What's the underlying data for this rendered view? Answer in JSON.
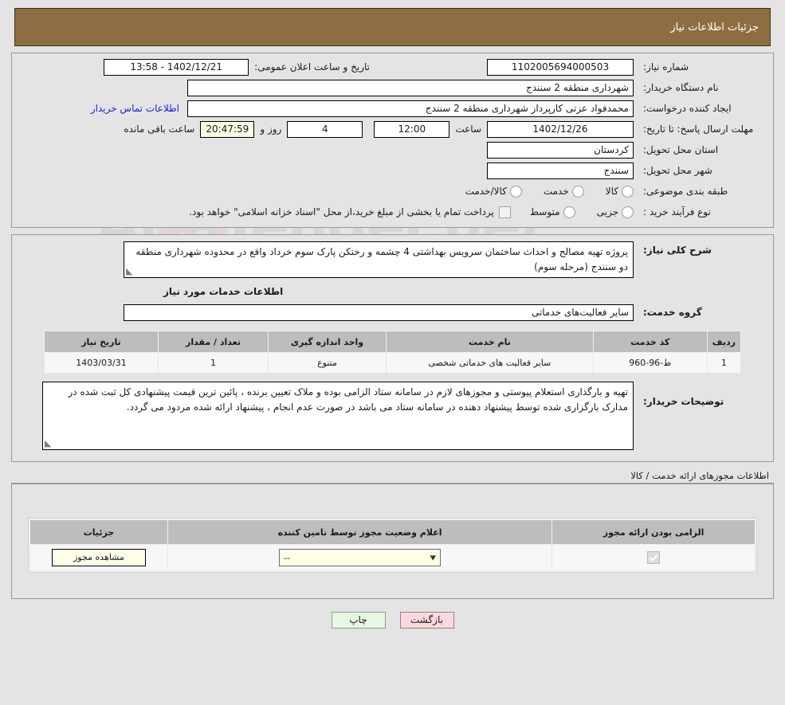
{
  "header": {
    "title": "جزئیات اطلاعات نیاز"
  },
  "form": {
    "need_number_label": "شماره نیاز:",
    "need_number_value": "1102005694000503",
    "public_announce_label": "تاریخ و ساعت اعلان عمومی:",
    "public_announce_value": "13:58 - 1402/12/21",
    "buyer_org_label": "نام دستگاه خریدار:",
    "buyer_org_value": "شهرداری منطقه 2 سنندج",
    "creator_label": "ایجاد کننده درخواست:",
    "creator_value": "محمدفواد عزتی کارپرداز شهرداری منطقه 2 سنندج",
    "contact_link": "اطلاعات تماس خریدار",
    "deadline_label": "مهلت ارسال پاسخ: تا تاریخ:",
    "deadline_date": "1402/12/26",
    "hour_label": "ساعت",
    "deadline_time": "12:00",
    "days_value": "4",
    "days_label": "روز و",
    "countdown_value": "20:47:59",
    "remaining_label": "ساعت باقی مانده",
    "province_label": "استان محل تحویل:",
    "province_value": "کردستان",
    "city_label": "شهر محل تحویل:",
    "city_value": "سنندج",
    "classification_label": "طبقه بندی موضوعی:",
    "classification_options": [
      "کالا",
      "خدمت",
      "کالا/خدمت"
    ],
    "purchase_type_label": "نوع فرآیند خرید :",
    "purchase_type_options": [
      "جزیی",
      "متوسط"
    ],
    "treasury_note": "پرداخت تمام یا بخشی از مبلغ خرید،از محل \"اسناد خزانه اسلامی\" خواهد بود."
  },
  "need": {
    "summary_label": "شرح کلی نیاز:",
    "summary_value": "پروژه تهیه مصالح و احداث ساختمان سرویس بهداشتی 4 چشمه و رختکن پارک سوم خرداد واقع در محدوده شهرداری منطقه دو سنندج (مرحله سوم)",
    "services_heading": "اطلاعات خدمات مورد نیاز",
    "service_group_label": "گروه خدمت:",
    "service_group_value": "سایر فعالیت‌های خدماتی",
    "notes_label": "توضیحات خریدار:",
    "notes_value": "تهیه و بارگذاری استعلام پیوستی و مجوزهای لازم در سامانه ستاد الزامی بوده و ملاک تعیین برنده ، پائین ترین قیمت پیشنهادی کل ثبت شده در مدارک بارگزاری شده توسط پیشنهاد دهنده در سامانه ستاد می باشد در صورت عدم انجام ، پیشنهاد ارائه شده مردود می گردد."
  },
  "services_table": {
    "columns": [
      "ردیف",
      "کد خدمت",
      "نام خدمت",
      "واحد اندازه گیری",
      "تعداد / مقدار",
      "تاریخ نیاز"
    ],
    "rows": [
      {
        "row_no": "1",
        "service_code": "ط-96-960",
        "service_name": "سایر فعالیت های خدماتی شخصی",
        "unit": "متنوع",
        "quantity": "1",
        "need_date": "1403/03/31"
      }
    ]
  },
  "licenses": {
    "section_title": "اطلاعات مجوزهای ارائه خدمت / کالا",
    "columns": [
      "الزامی بودن ارائه مجوز",
      "اعلام وضعیت مجوز توسط تامین کننده",
      "جزئیات"
    ],
    "rows": [
      {
        "required_checked": true,
        "status_value": "--",
        "details_button": "مشاهده مجوز"
      }
    ]
  },
  "footer": {
    "back_button": "بازگشت",
    "print_button": "چاپ"
  },
  "watermark": {
    "text": "AriaTender.net"
  }
}
